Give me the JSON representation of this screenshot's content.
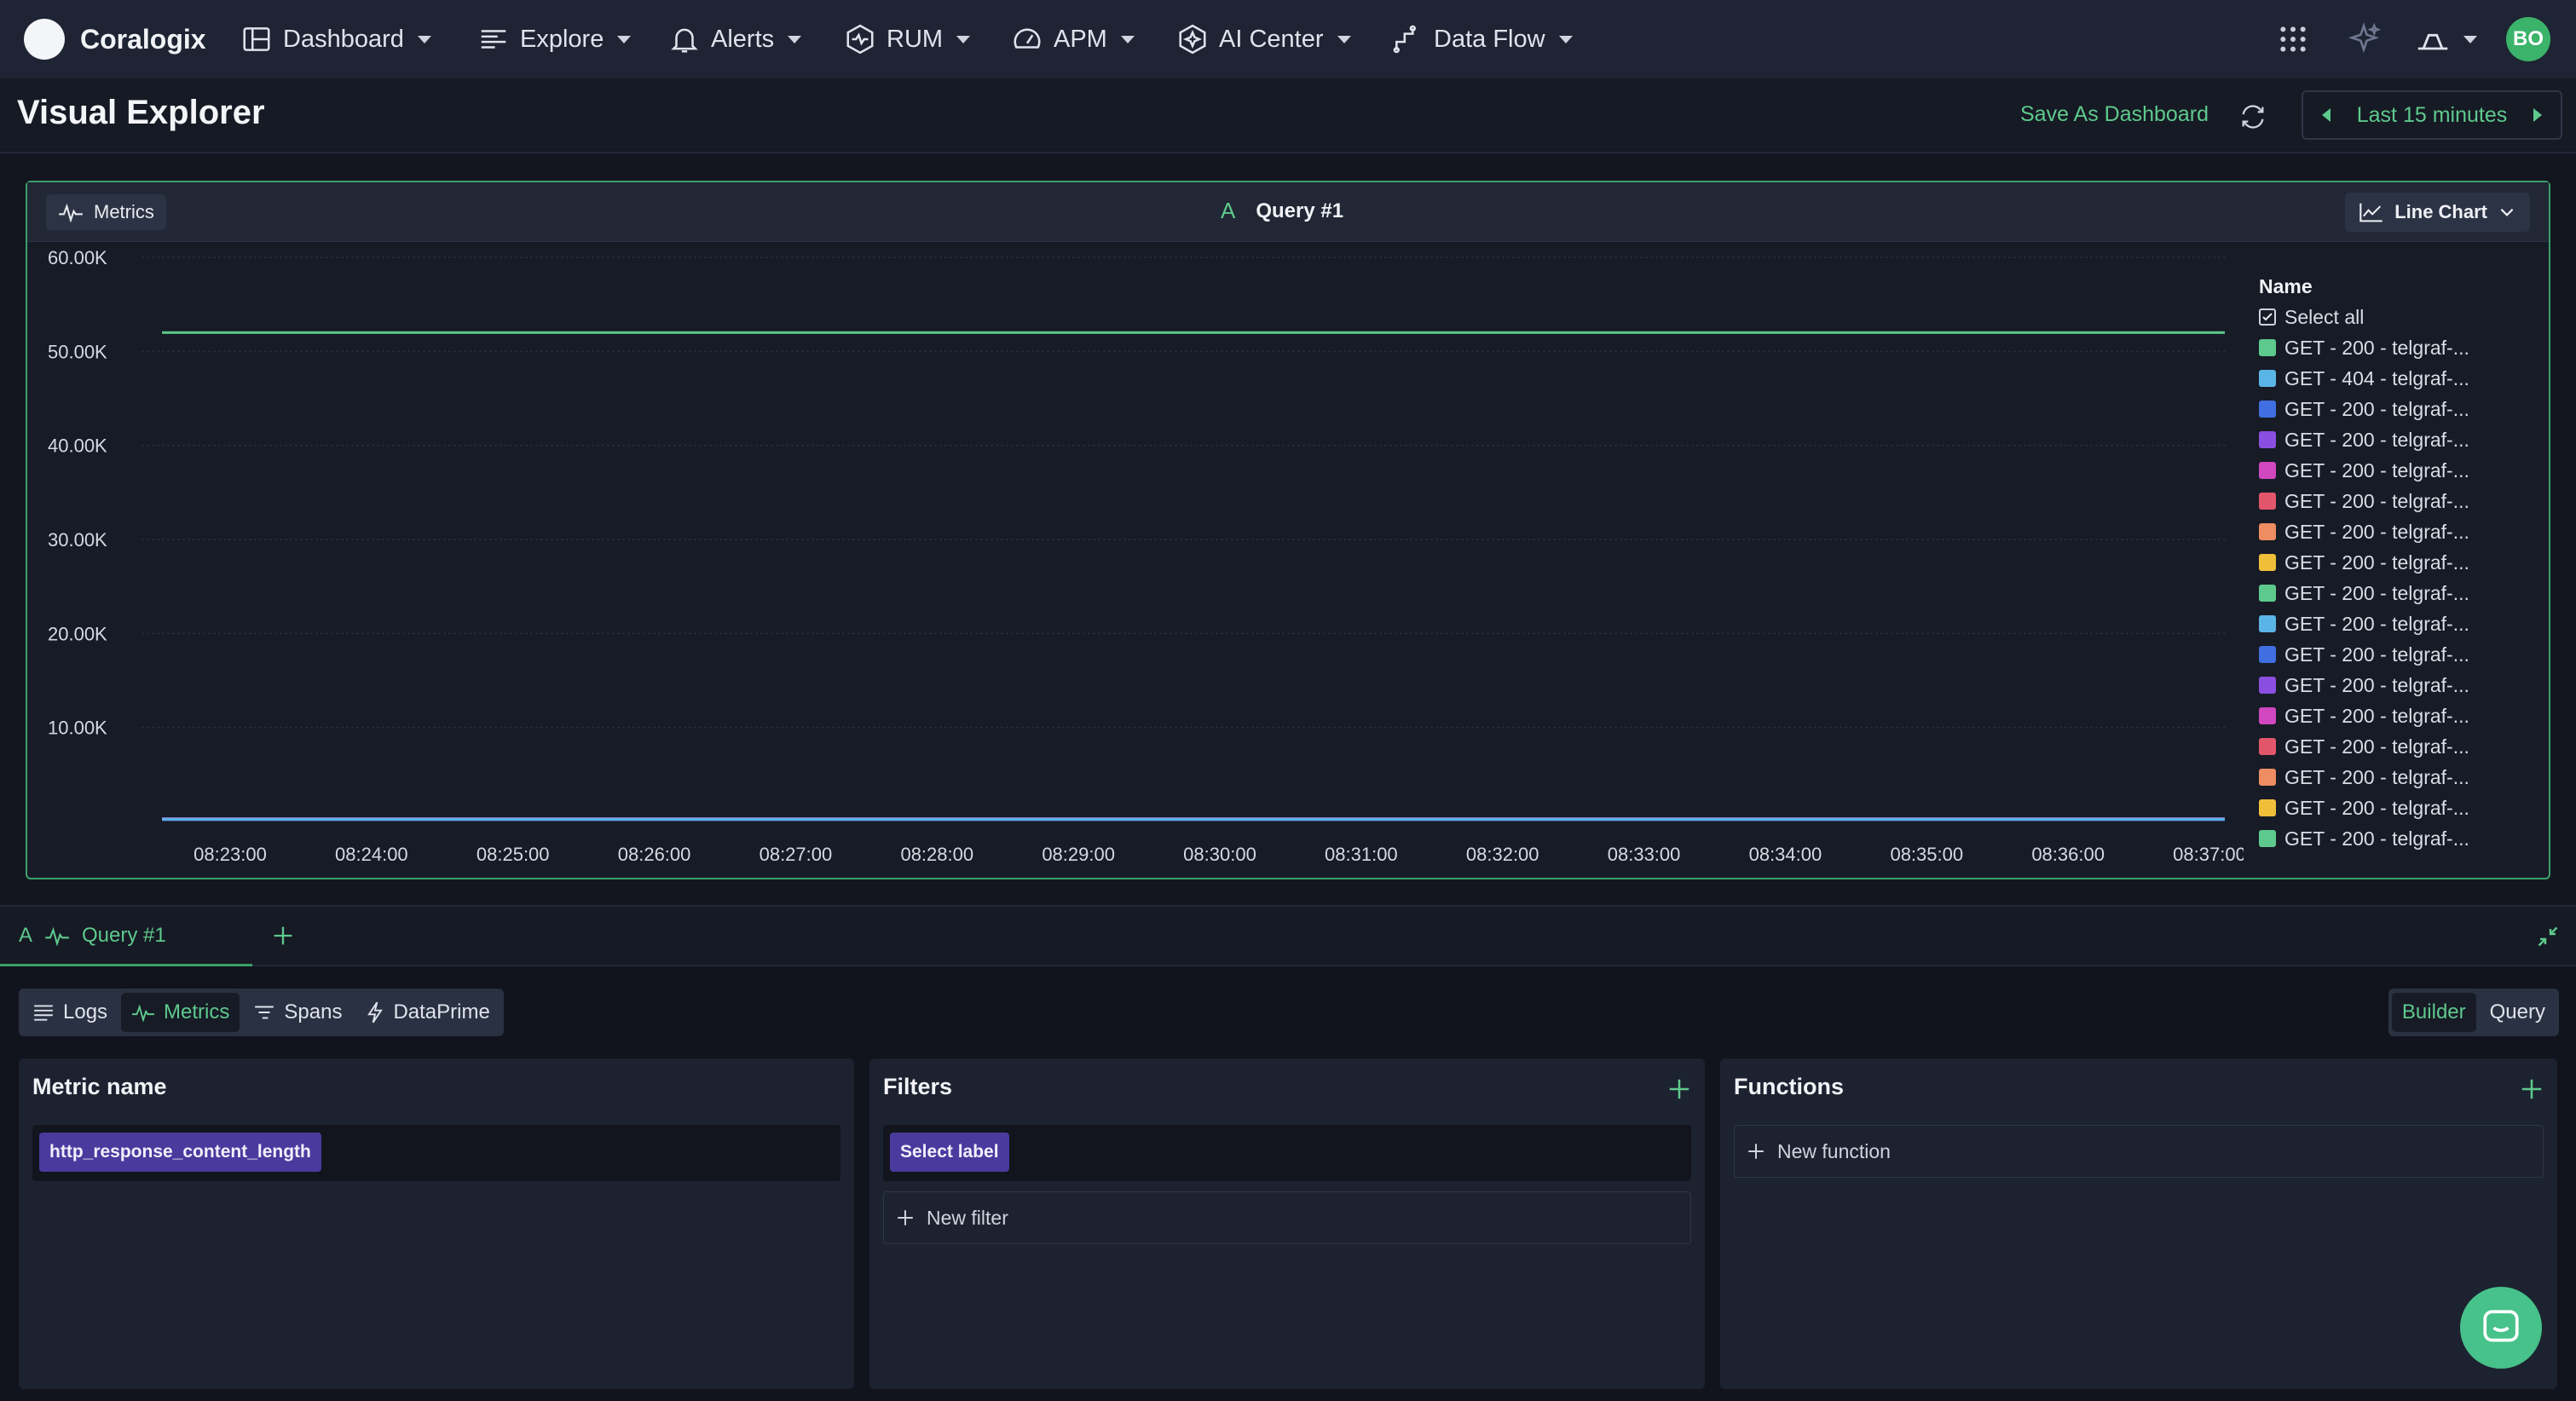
{
  "nav": {
    "brand": "Coralogix",
    "items": [
      {
        "label": "Dashboard",
        "icon": "dashboard-icon"
      },
      {
        "label": "Explore",
        "icon": "explore-icon"
      },
      {
        "label": "Alerts",
        "icon": "bell-icon"
      },
      {
        "label": "RUM",
        "icon": "rum-icon"
      },
      {
        "label": "APM",
        "icon": "gauge-icon"
      },
      {
        "label": "AI Center",
        "icon": "ai-center-icon"
      },
      {
        "label": "Data Flow",
        "icon": "data-flow-icon"
      }
    ],
    "user_initials": "BO"
  },
  "header": {
    "title": "Visual Explorer",
    "save_label": "Save As Dashboard",
    "time_range": "Last 15 minutes"
  },
  "chart_panel": {
    "data_source": "Metrics",
    "query_letter": "A",
    "query_name": "Query #1",
    "chart_type": "Line Chart"
  },
  "chart_data": {
    "type": "line",
    "title": "",
    "xlabel": "",
    "ylabel": "",
    "ylim": [
      0,
      60000
    ],
    "yticks": [
      "10.00K",
      "20.00K",
      "30.00K",
      "40.00K",
      "50.00K",
      "60.00K"
    ],
    "x": [
      "08:23:00",
      "08:24:00",
      "08:25:00",
      "08:26:00",
      "08:27:00",
      "08:28:00",
      "08:29:00",
      "08:30:00",
      "08:31:00",
      "08:32:00",
      "08:33:00",
      "08:34:00",
      "08:35:00",
      "08:36:00",
      "08:37:00"
    ],
    "grid": true,
    "legend_position": "right",
    "legend_title": "Name",
    "select_all_label": "Select all",
    "series": [
      {
        "name": "GET - 200 - telgraf-...",
        "color": "#5ec98d",
        "value": 52000
      },
      {
        "name": "GET - 404 - telgraf-...",
        "color": "#5bb4e6",
        "value": 300
      },
      {
        "name": "GET - 200 - telgraf-...",
        "color": "#3f6fe0",
        "value": 300
      },
      {
        "name": "GET - 200 - telgraf-...",
        "color": "#8a4fe0",
        "value": 300
      },
      {
        "name": "GET - 200 - telgraf-...",
        "color": "#d047c0",
        "value": 300
      },
      {
        "name": "GET - 200 - telgraf-...",
        "color": "#e2566b",
        "value": 300
      },
      {
        "name": "GET - 200 - telgraf-...",
        "color": "#ee8c62",
        "value": 300
      },
      {
        "name": "GET - 200 - telgraf-...",
        "color": "#f0bf3a",
        "value": 300
      },
      {
        "name": "GET - 200 - telgraf-...",
        "color": "#5ec98d",
        "value": 300
      },
      {
        "name": "GET - 200 - telgraf-...",
        "color": "#5bb4e6",
        "value": 300
      },
      {
        "name": "GET - 200 - telgraf-...",
        "color": "#3f6fe0",
        "value": 300
      },
      {
        "name": "GET - 200 - telgraf-...",
        "color": "#8a4fe0",
        "value": 300
      },
      {
        "name": "GET - 200 - telgraf-...",
        "color": "#d047c0",
        "value": 300
      },
      {
        "name": "GET - 200 - telgraf-...",
        "color": "#e2566b",
        "value": 300
      },
      {
        "name": "GET - 200 - telgraf-...",
        "color": "#ee8c62",
        "value": 300
      },
      {
        "name": "GET - 200 - telgraf-...",
        "color": "#f0bf3a",
        "value": 300
      },
      {
        "name": "GET - 200 - telgraf-...",
        "color": "#5ec98d",
        "value": 300
      }
    ]
  },
  "query_tabs": {
    "letter": "A",
    "label": "Query #1"
  },
  "builder": {
    "sources": [
      "Logs",
      "Metrics",
      "Spans",
      "DataPrime"
    ],
    "active_source": "Metrics",
    "modes": [
      "Builder",
      "Query"
    ],
    "active_mode": "Builder",
    "metric_name": {
      "title": "Metric name",
      "value": "http_response_content_length"
    },
    "filters": {
      "title": "Filters",
      "label_chip": "Select label",
      "add_label": "New filter"
    },
    "functions": {
      "title": "Functions",
      "add_label": "New function"
    }
  },
  "colors": {
    "accent": "#5ec98d",
    "chip": "#4a3a9e",
    "nav_bg": "#1e2433"
  }
}
